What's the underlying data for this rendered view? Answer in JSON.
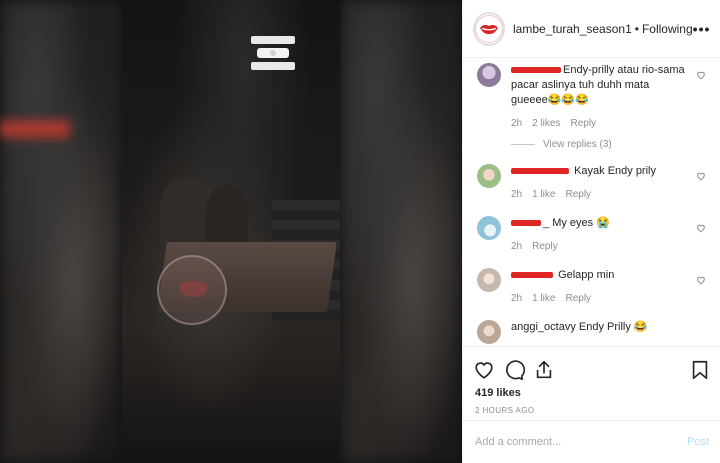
{
  "header": {
    "username": "lambe_turah_season1",
    "separator": "•",
    "follow_status": "Following",
    "more_icon": "more-icon"
  },
  "comments": [
    {
      "text": "Endy-prilly atau rio-sama pacar aslinya tuh duhh mata gueeee😂😂😂",
      "time": "2h",
      "likes": "2 likes",
      "reply": "Reply",
      "view_replies": "View replies (3)"
    },
    {
      "text": "Kayak Endy prily",
      "time": "2h",
      "likes": "1 like",
      "reply": "Reply"
    },
    {
      "text": "My eyes 😭",
      "prefix_after_redact": "_",
      "time": "2h",
      "reply": "Reply"
    },
    {
      "text": "Gelapp min",
      "time": "2h",
      "likes": "1 like",
      "reply": "Reply"
    },
    {
      "username": "anggi_octavy",
      "text": "Endy Prilly 😂"
    }
  ],
  "likes_count": "419 likes",
  "posted_time": "2 HOURS AGO",
  "add_comment": {
    "placeholder": "Add a comment...",
    "post_label": "Post"
  },
  "colors": {
    "redaction": "#e02525",
    "post_button": "#b2dffc",
    "meta_text": "#8e8e8e"
  }
}
